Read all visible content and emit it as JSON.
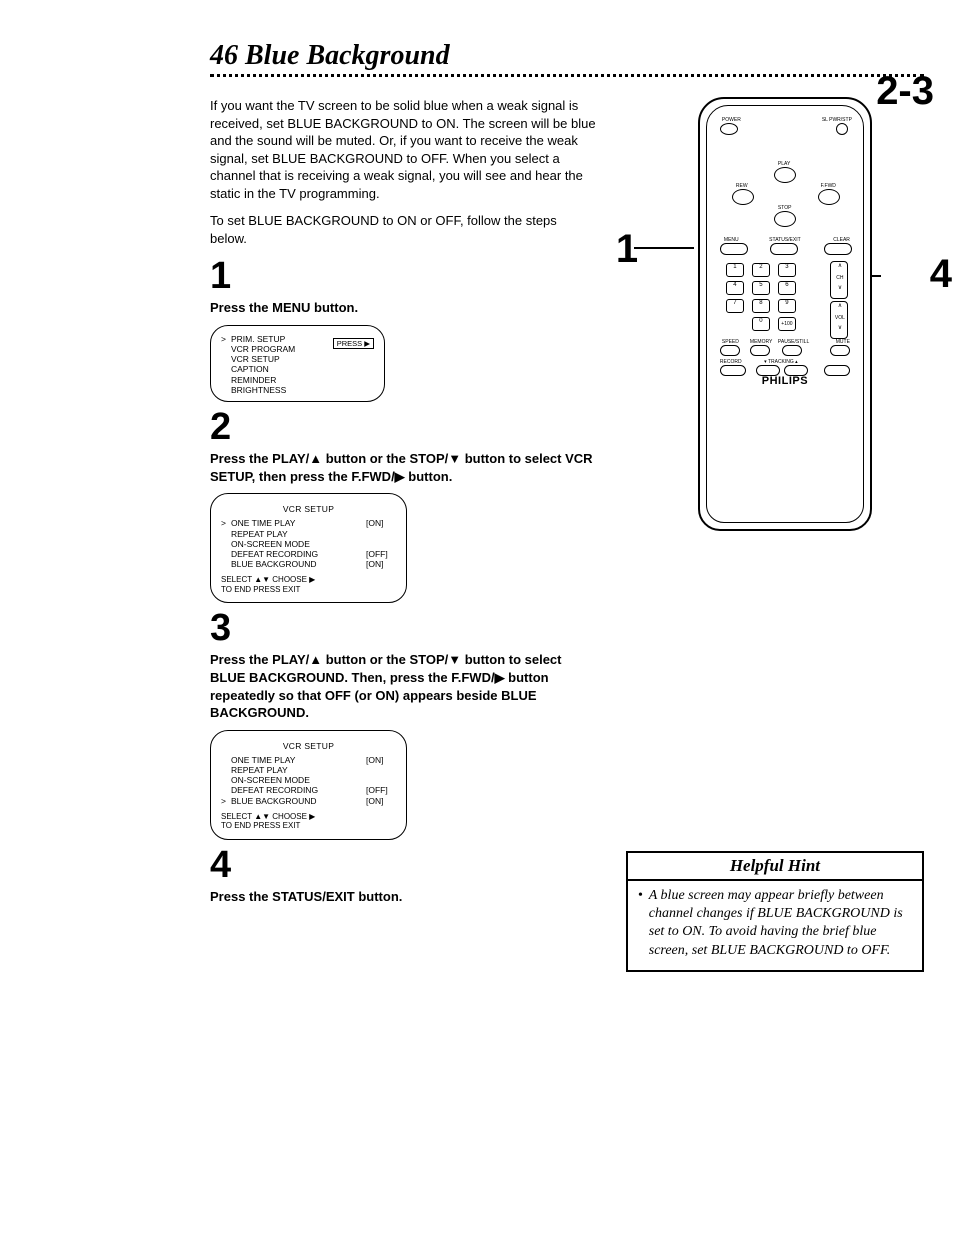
{
  "page_number": "46",
  "page_title": "Blue Background",
  "intro_p1": "If you want the TV screen to be solid blue when a weak signal is received, set BLUE BACKGROUND to ON. The screen will be blue and the sound will be muted. Or, if you want to receive the weak signal, set BLUE BACKGROUND to OFF. When you select a channel that is receiving a weak signal, you will see and hear the static in the TV programming.",
  "intro_p2": "To set BLUE BACKGROUND to ON or OFF, follow the steps below.",
  "steps": {
    "s1_num": "1",
    "s1_text": "Press the MENU button.",
    "s2_num": "2",
    "s2_text": "Press the PLAY/▲ button or the STOP/▼ button to select VCR SETUP, then press the F.FWD/▶ button.",
    "s3_num": "3",
    "s3_text": "Press the PLAY/▲ button or the STOP/▼ button to select BLUE BACKGROUND. Then, press the F.FWD/▶ button repeatedly so that OFF (or ON) appears beside BLUE BACKGROUND.",
    "s4_num": "4",
    "s4_text": "Press the STATUS/EXIT button."
  },
  "osd1": {
    "press_btn": "PRESS ▶",
    "items": [
      {
        "caret": ">",
        "label": "PRIM. SETUP"
      },
      {
        "caret": "",
        "label": "VCR PROGRAM"
      },
      {
        "caret": "",
        "label": "VCR SETUP"
      },
      {
        "caret": "",
        "label": "CAPTION"
      },
      {
        "caret": "",
        "label": "REMINDER"
      },
      {
        "caret": "",
        "label": "BRIGHTNESS"
      }
    ]
  },
  "osd2": {
    "title": "VCR SETUP",
    "items": [
      {
        "caret": ">",
        "label": "ONE TIME PLAY",
        "val": "[ON]"
      },
      {
        "caret": "",
        "label": "REPEAT PLAY",
        "val": ""
      },
      {
        "caret": "",
        "label": "ON-SCREEN MODE",
        "val": ""
      },
      {
        "caret": "",
        "label": "DEFEAT RECORDING",
        "val": "[OFF]"
      },
      {
        "caret": "",
        "label": "BLUE BACKGROUND",
        "val": "[ON]"
      }
    ],
    "footer1": "SELECT ▲▼ CHOOSE ▶",
    "footer2": "TO END PRESS EXIT"
  },
  "osd3": {
    "title": "VCR SETUP",
    "items": [
      {
        "caret": "",
        "label": "ONE TIME PLAY",
        "val": "[ON]"
      },
      {
        "caret": "",
        "label": "REPEAT PLAY",
        "val": ""
      },
      {
        "caret": "",
        "label": "ON-SCREEN MODE",
        "val": ""
      },
      {
        "caret": "",
        "label": "DEFEAT RECORDING",
        "val": "[OFF]"
      },
      {
        "caret": ">",
        "label": "BLUE BACKGROUND",
        "val": "[ON]"
      }
    ],
    "footer1": "SELECT ▲▼ CHOOSE ▶",
    "footer2": "TO END PRESS EXIT"
  },
  "callouts": {
    "c1": "1",
    "c23": "2-3",
    "c4": "4"
  },
  "remote": {
    "power": "POWER",
    "slpower": "SL PWR/STP",
    "play": "PLAY",
    "rew": "REW",
    "ffwd": "F.FWD",
    "stop": "STOP",
    "menu": "MENU",
    "statusexit": "STATUS/EXIT",
    "clear": "CLEAR",
    "n1": "1",
    "n2": "2",
    "n3": "3",
    "n4": "4",
    "n5": "5",
    "n6": "6",
    "n7": "7",
    "n8": "8",
    "n9": "9",
    "n0": "0",
    "plus100": "+100",
    "ch": "CH",
    "vol": "VOL",
    "up": "∧",
    "down": "∨",
    "speed": "SPEED",
    "memory": "MEMORY",
    "pause": "PAUSE/STILL",
    "mute": "MUTE",
    "record": "RECORD",
    "tracking": "▾ TRACKING ▴",
    "brand": "PHILIPS"
  },
  "hint": {
    "title": "Helpful Hint",
    "bullet": "•",
    "text": "A blue screen may appear briefly between channel changes if BLUE BACKGROUND is set to ON. To avoid having the brief blue screen, set BLUE BACKGROUND to OFF."
  }
}
